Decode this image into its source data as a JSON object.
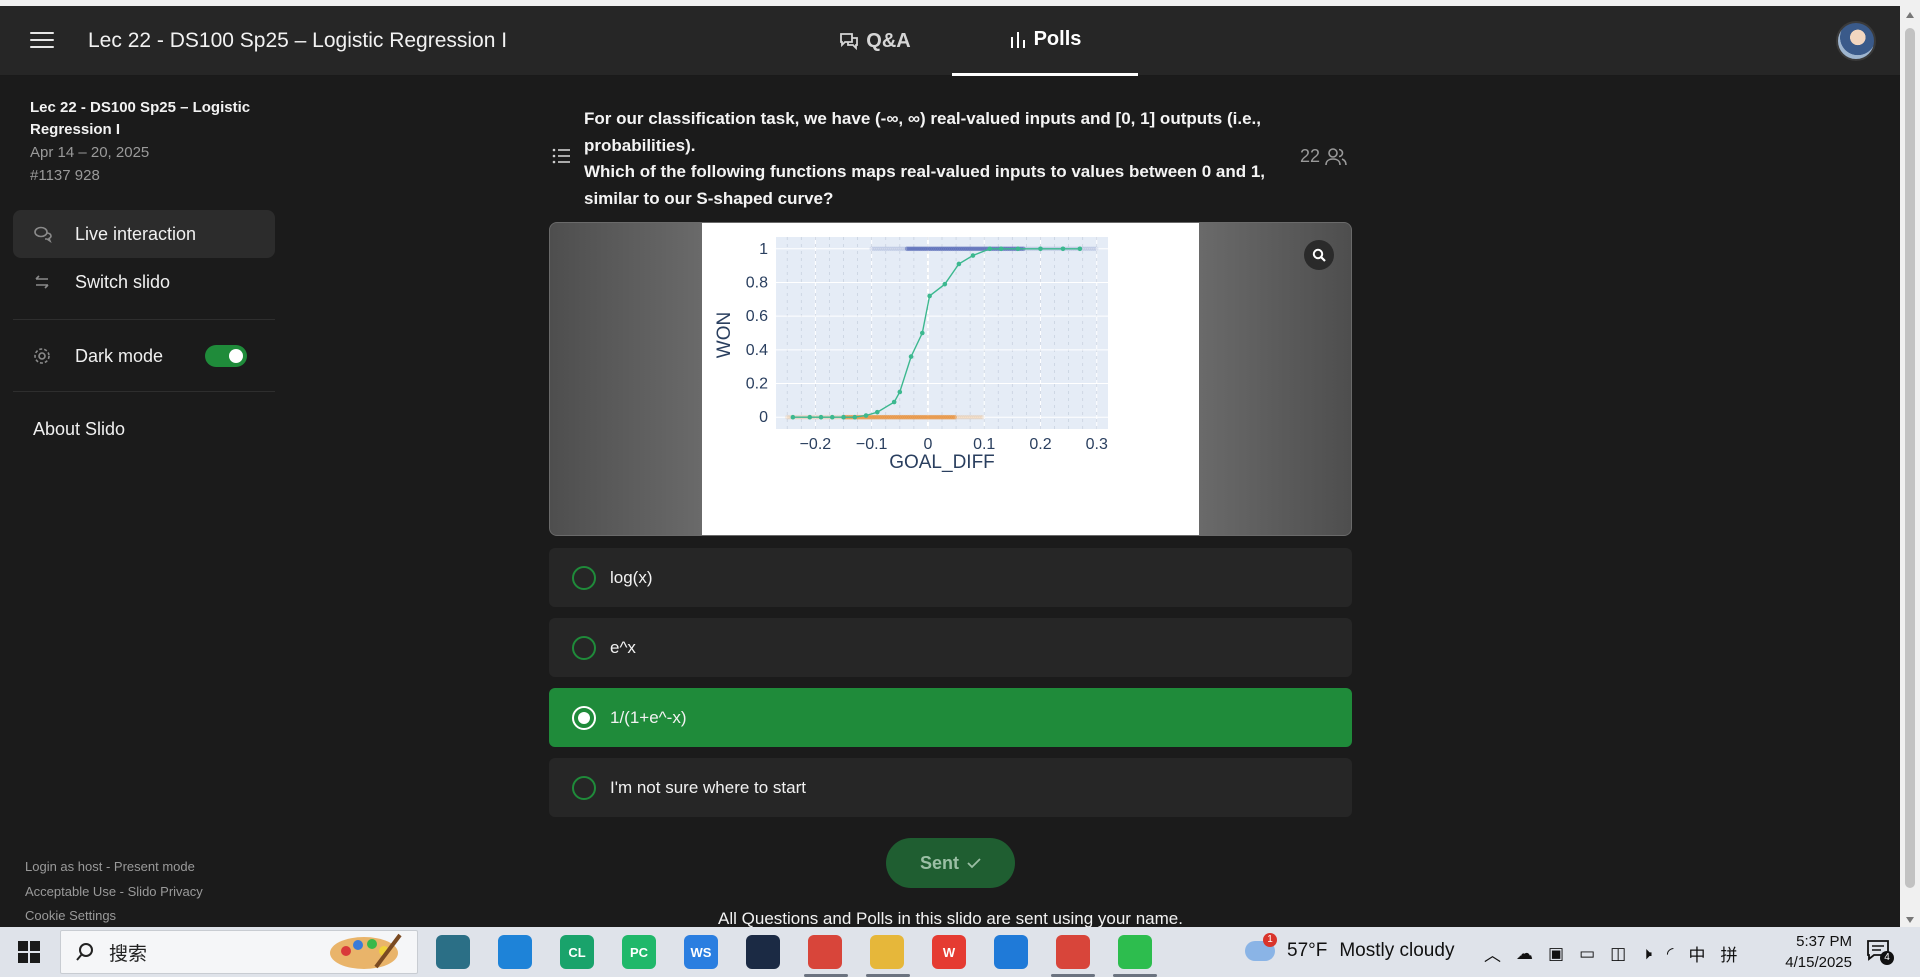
{
  "header": {
    "event_title": "Lec 22 - DS100 Sp25 – Logistic Regression I",
    "tabs": [
      {
        "label": "Q&A",
        "icon": "speech-bubbles-icon",
        "active": false
      },
      {
        "label": "Polls",
        "icon": "bar-chart-icon",
        "active": true
      }
    ]
  },
  "sidebar": {
    "event_title": "Lec 22 - DS100 Sp25 – Logistic Regression I",
    "dates": "Apr 14 – 20, 2025",
    "code": "#1137 928",
    "items": [
      {
        "label": "Live interaction",
        "icon": "chat-bubbles-icon"
      },
      {
        "label": "Switch slido",
        "icon": "swap-arrows-icon"
      },
      {
        "label": "Dark mode",
        "icon": "gear-icon",
        "toggle_on": true
      }
    ],
    "about": "About Slido",
    "footer": {
      "login": "Login as host",
      "present": "Present mode",
      "acceptable_use": "Acceptable Use",
      "privacy": "Slido Privacy",
      "cookies": "Cookie Settings"
    }
  },
  "poll": {
    "question_line1": "For our classification task, we have (-∞, ∞) real-valued inputs and [0, 1] outputs (i.e., probabilities).",
    "question_line2": "Which of the following functions maps real-valued inputs to values between 0 and 1, similar to our S-shaped curve?",
    "participants": "22",
    "options": [
      {
        "label": "log(x)",
        "selected": false
      },
      {
        "label": "e^x",
        "selected": false
      },
      {
        "label": "1/(1+e^-x)",
        "selected": true
      },
      {
        "label": "I'm not sure where to start",
        "selected": false
      }
    ],
    "sent_label": "Sent",
    "notice": "All Questions and Polls in this slido are sent using your name."
  },
  "chart_data": {
    "type": "scatter",
    "xlabel": "GOAL_DIFF",
    "ylabel": "WON",
    "xlim": [
      -0.27,
      0.32
    ],
    "ylim": [
      -0.07,
      1.07
    ],
    "xticks": [
      -0.2,
      -0.1,
      0,
      0.1,
      0.2,
      0.3
    ],
    "xtick_labels": [
      "−0.2",
      "−0.1",
      "0",
      "0.1",
      "0.2",
      "0.3"
    ],
    "yticks": [
      0,
      0.2,
      0.4,
      0.6,
      0.8,
      1
    ],
    "ytick_labels": [
      "0",
      "0.2",
      "0.4",
      "0.6",
      "0.8",
      "1"
    ],
    "grid": true,
    "series": [
      {
        "color": "#3cb88f",
        "style": "line+markers",
        "x": [
          -0.24,
          -0.21,
          -0.19,
          -0.17,
          -0.15,
          -0.13,
          -0.11,
          -0.09,
          -0.06,
          -0.05,
          -0.03,
          -0.01,
          0.003,
          0.03,
          0.055,
          0.08,
          0.11,
          0.13,
          0.16,
          0.2,
          0.24,
          0.27
        ],
        "y": [
          0,
          0,
          0,
          0,
          0,
          0,
          0.01,
          0.03,
          0.09,
          0.15,
          0.36,
          0.5,
          0.72,
          0.79,
          0.91,
          0.96,
          1,
          1,
          1,
          1,
          1,
          1
        ]
      }
    ],
    "rug": [
      {
        "y": 1,
        "color": "#4a5fb0",
        "x_from": -0.1,
        "x_to": 0.3,
        "dense_from": -0.04,
        "dense_to": 0.17
      },
      {
        "y": 0,
        "color": "#e8892b",
        "x_from": -0.25,
        "x_to": 0.1,
        "dense_from": -0.15,
        "dense_to": 0.05
      }
    ]
  },
  "taskbar": {
    "search_placeholder": "搜索",
    "apps": [
      {
        "icon": "brain-app-icon",
        "color": "#2b6f86",
        "label": ""
      },
      {
        "icon": "edge-browser-icon",
        "color": "#1e83d8",
        "label": ""
      },
      {
        "icon": "clion-icon",
        "color": "#19a36b",
        "label": "CL"
      },
      {
        "icon": "pycharm-icon",
        "color": "#20b86a",
        "label": "PC"
      },
      {
        "icon": "webstorm-icon",
        "color": "#2a7ee0",
        "label": "WS"
      },
      {
        "icon": "steam-icon",
        "color": "#1b2a44",
        "label": ""
      },
      {
        "icon": "chrome-icon",
        "color": "#d8453a",
        "label": ""
      },
      {
        "icon": "file-explorer-icon",
        "color": "#e6b73a",
        "label": ""
      },
      {
        "icon": "wps-icon",
        "color": "#e53b32",
        "label": "W"
      },
      {
        "icon": "vscode-icon",
        "color": "#1f7ad8",
        "label": ""
      },
      {
        "icon": "chrome-profile-icon",
        "color": "#d8453a",
        "label": ""
      },
      {
        "icon": "wechat-icon",
        "color": "#2dbd4e",
        "label": ""
      }
    ],
    "weather": {
      "temp": "57°F",
      "condition": "Mostly cloudy",
      "badge": "1"
    },
    "ime": "中",
    "ime2": "拼",
    "time": "5:37 PM",
    "date": "4/15/2025",
    "notifications": "4"
  }
}
